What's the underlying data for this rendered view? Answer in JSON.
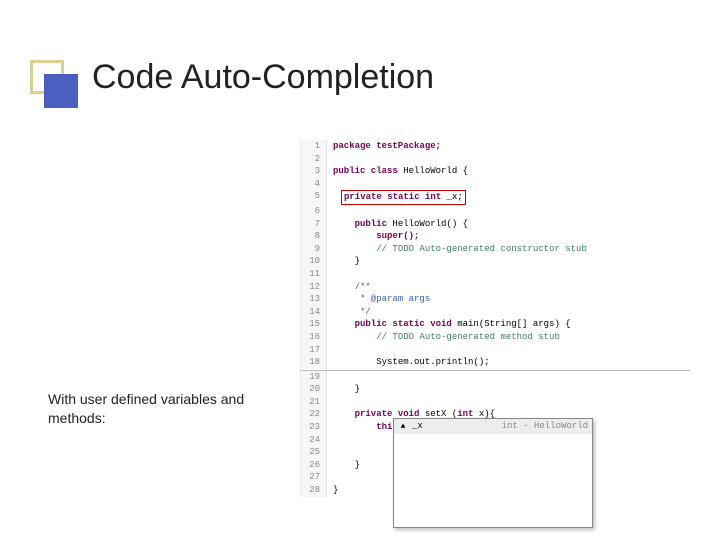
{
  "title": "Code Auto-Completion",
  "caption": "With user defined variables and methods:",
  "lines": {
    "l1": "package testPackage;",
    "l3a": "public class",
    "l3b": " HelloWorld {",
    "l5a": "private static int",
    "l5b": " _x;",
    "l7a": "public",
    "l7b": " HelloWorld() {",
    "l8": "super();",
    "l9": "// TODO Auto-generated constructor stub",
    "l10": "}",
    "l12": "/**",
    "l13": " * @param args",
    "l14": " */",
    "l15a": "public static void",
    "l15b": " main(String[] args) {",
    "l16": "// TODO Auto-generated method stub",
    "l18": "System.out.println();",
    "l20": "}",
    "l22a": "private void",
    "l22b": " setX (",
    "l22c": "int",
    "l22d": " x){",
    "l23a": "this",
    "l23b": "._",
    "l26": "}",
    "l28": "}"
  },
  "gutter": {
    "n1": "1",
    "n2": "2",
    "n3": "3",
    "n4": "4",
    "n5": "5",
    "n6": "6",
    "n7": "7",
    "n8": "8",
    "n9": "9",
    "n10": "10",
    "n11": "11",
    "n12": "12",
    "n13": "13",
    "n14": "14",
    "n15": "15",
    "n16": "16",
    "n17": "17",
    "n18": "18",
    "n19": "19",
    "n20": "20",
    "n21": "21",
    "n22": "22",
    "n23": "23",
    "n24": "24",
    "n25": "25",
    "n26": "26",
    "n27": "27",
    "n28": "28"
  },
  "popup": {
    "item_icon": "▲",
    "item_text": "_x",
    "item_type": "int - HelloWorld"
  }
}
